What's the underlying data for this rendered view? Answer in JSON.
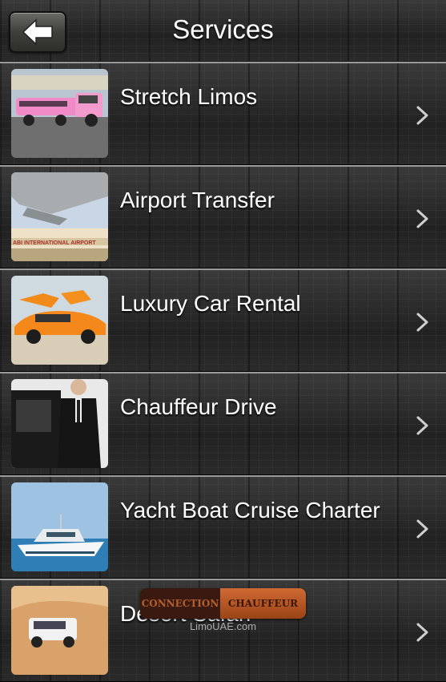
{
  "header": {
    "title": "Services"
  },
  "services": [
    {
      "label": "Stretch Limos",
      "thumb": "pink-stretch-limo-photo"
    },
    {
      "label": "Airport Transfer",
      "thumb": "airport-terminal-photo",
      "thumb_text": "ABI INTERNATIONAL AIRPORT"
    },
    {
      "label": "Luxury Car Rental",
      "thumb": "orange-supercar-photo"
    },
    {
      "label": "Chauffeur Drive",
      "thumb": "chauffeur-photo"
    },
    {
      "label": "Yacht Boat Cruise Charter",
      "thumb": "yacht-photo"
    },
    {
      "label": "Desert Safari",
      "thumb": "desert-suv-photo"
    }
  ],
  "watermark": {
    "left": "CONNECTION",
    "right": "CHAUFFEUR",
    "site": "LimoUAE.com"
  },
  "icons": {
    "back": "back-arrow-icon",
    "chevron": "chevron-right-icon"
  }
}
